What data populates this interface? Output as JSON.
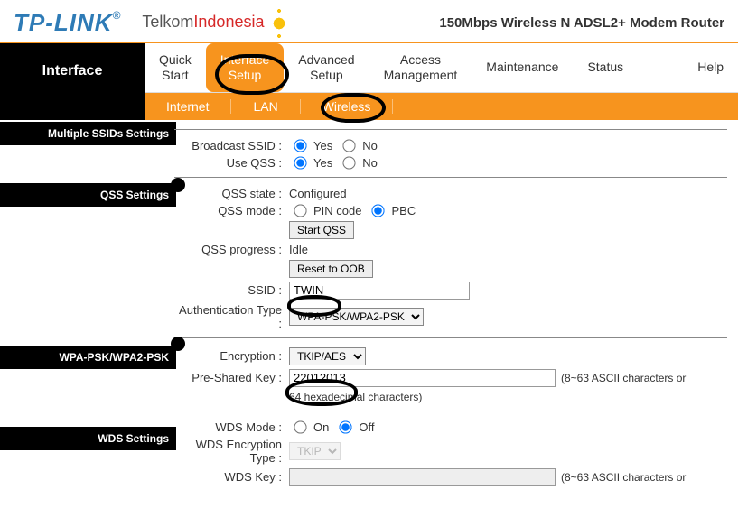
{
  "header": {
    "brand": "TP-LINK",
    "cobrand1": "Telkom",
    "cobrand2": "Indonesia",
    "product": "150Mbps Wireless N ADSL2+ Modem Router"
  },
  "nav": {
    "side_label": "Interface",
    "tabs": [
      "Quick\nStart",
      "Interface\nSetup",
      "Advanced\nSetup",
      "Access\nManagement",
      "Maintenance",
      "Status",
      "Help"
    ],
    "active_tab": 1,
    "subtabs": [
      "Internet",
      "LAN",
      "Wireless"
    ],
    "active_subtab": 2
  },
  "sections": {
    "multi_ssid": "Multiple SSIDs Settings",
    "qss": "QSS Settings",
    "wpa": "WPA-PSK/WPA2-PSK",
    "wds": "WDS Settings"
  },
  "multi": {
    "broadcast_label": "Broadcast SSID :",
    "useqss_label": "Use QSS :",
    "yes": "Yes",
    "no": "No"
  },
  "qss": {
    "state_label": "QSS state :",
    "state_value": "Configured",
    "mode_label": "QSS mode :",
    "pin": "PIN code",
    "pbc": "PBC",
    "start_btn": "Start QSS",
    "progress_label": "QSS progress :",
    "progress_value": "Idle",
    "reset_btn": "Reset to OOB",
    "ssid_label": "SSID :",
    "ssid_value": "TWIN",
    "auth_label": "Authentication Type :",
    "auth_value": "WPA-PSK/WPA2-PSK"
  },
  "wpa": {
    "enc_label": "Encryption :",
    "enc_value": "TKIP/AES",
    "psk_label": "Pre-Shared Key :",
    "psk_value": "22012013",
    "psk_hint1": "(8~63 ASCII characters or",
    "psk_hint2": "64 hexadecimal characters)"
  },
  "wds": {
    "mode_label": "WDS Mode :",
    "on": "On",
    "off": "Off",
    "enc_label": "WDS Encryption Type :",
    "enc_value": "TKIP",
    "key_label": "WDS Key :",
    "key_hint": "(8~63 ASCII characters or"
  }
}
